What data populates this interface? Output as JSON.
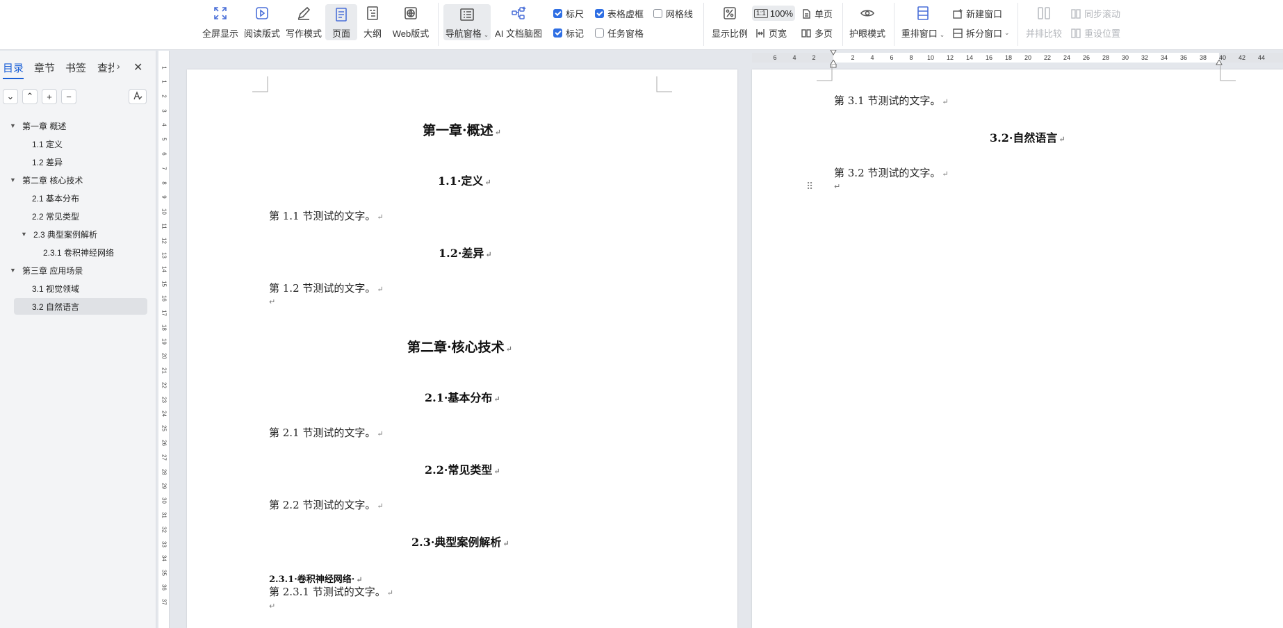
{
  "ribbon": {
    "view_buttons": [
      {
        "label": "全屏显示",
        "icon": "fullscreen-icon"
      },
      {
        "label": "阅读版式",
        "icon": "reading-layout-icon"
      },
      {
        "label": "写作模式",
        "icon": "pen-icon"
      },
      {
        "label": "页面",
        "icon": "page-layout-icon"
      },
      {
        "label": "大纲",
        "icon": "outline-icon"
      },
      {
        "label": "Web版式",
        "icon": "globe-icon"
      }
    ],
    "nav_pane": {
      "label": "导航窗格",
      "icon": "nav-pane-icon"
    },
    "ai_mindmap": {
      "label": "AI 文档脑图",
      "icon": "mindmap-icon"
    },
    "checks": {
      "ruler": {
        "label": "标尺",
        "checked": true
      },
      "table_gridlines": {
        "label": "表格虚框",
        "checked": true
      },
      "grid": {
        "label": "网格线",
        "checked": false
      },
      "marks": {
        "label": "标记",
        "checked": true
      },
      "task_pane": {
        "label": "任务窗格",
        "checked": false
      }
    },
    "zoom": {
      "label": "显示比例",
      "value": "100%",
      "page_width": "页宽",
      "single_page": "单页",
      "multi_page": "多页"
    },
    "eye_mode": {
      "label": "护眼模式"
    },
    "window": {
      "rearrange": "重排窗口",
      "new_window": "新建窗口",
      "split": "拆分窗口"
    },
    "compare": {
      "side_by_side": "并排比较",
      "sync_scroll": "同步滚动",
      "reset_pos": "重设位置"
    }
  },
  "nav": {
    "tabs": [
      "目录",
      "章节",
      "书签",
      "查找"
    ],
    "active_tab": "目录",
    "toc": [
      {
        "label": "第一章  概述",
        "level": 1,
        "expand": true
      },
      {
        "label": "1.1  定义",
        "level": 2,
        "expand": null
      },
      {
        "label": "1.2  差异",
        "level": 2,
        "expand": null
      },
      {
        "label": "第二章  核心技术",
        "level": 1,
        "expand": true
      },
      {
        "label": "2.1  基本分布",
        "level": 2,
        "expand": null
      },
      {
        "label": "2.2  常见类型",
        "level": 2,
        "expand": null
      },
      {
        "label": "2.3  典型案例解析",
        "level": 2,
        "expand": true
      },
      {
        "label": "2.3.1  卷积神经网络",
        "level": 3,
        "expand": null
      },
      {
        "label": "第三章  应用场景",
        "level": 1,
        "expand": true
      },
      {
        "label": "3.1  视觉领域",
        "level": 2,
        "expand": null
      },
      {
        "label": "3.2  自然语言",
        "level": 2,
        "expand": null,
        "selected": true
      }
    ]
  },
  "vruler_numbers": [
    "1",
    "1",
    "2",
    "3",
    "4",
    "5",
    "6",
    "7",
    "8",
    "9",
    "10",
    "11",
    "12",
    "13",
    "14",
    "15",
    "16",
    "17",
    "18",
    "19",
    "20",
    "21",
    "22",
    "23",
    "24",
    "25",
    "26",
    "27",
    "28",
    "29",
    "30",
    "31",
    "32",
    "33",
    "34",
    "35",
    "36",
    "37"
  ],
  "hruler_numbers": [
    "6",
    "4",
    "2",
    "2",
    "4",
    "6",
    "8",
    "10",
    "12",
    "14",
    "16",
    "18",
    "20",
    "22",
    "24",
    "26",
    "28",
    "30",
    "32",
    "34",
    "36",
    "38",
    "40",
    "42",
    "44"
  ],
  "page1": {
    "ch1_title": "第一章·概述",
    "s11_title": "1.1·定义",
    "s11_body": "第 1.1 节测试的文字。",
    "s12_title": "1.2·差异",
    "s12_body": "第 1.2 节测试的文字。",
    "ch2_title": "第二章·核心技术",
    "s21_title": "2.1·基本分布",
    "s21_body": "第 2.1 节测试的文字。",
    "s22_title": "2.2·常见类型",
    "s22_body": "第 2.2 节测试的文字。",
    "s23_title": "2.3·典型案例解析",
    "s231_title": "2.3.1·卷积神经网络·",
    "s231_body": "第 2.3.1 节测试的文字。"
  },
  "page2": {
    "s31_body": "第 3.1 节测试的文字。",
    "s32_title": "3.2·自然语言",
    "s32_body": "第 3.2 节测试的文字。"
  },
  "para_mark": "↵"
}
